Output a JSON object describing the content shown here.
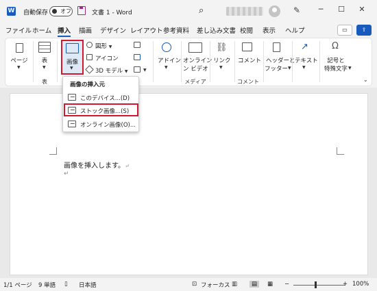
{
  "titlebar": {
    "autosave_label": "自動保存",
    "autosave_state": "オフ",
    "doc_title": "文書 1  -  Word",
    "search_icon": "search-icon",
    "minimize": "─",
    "maximize": "☐",
    "close": "✕"
  },
  "tabs": [
    "ファイル",
    "ホーム",
    "挿入",
    "描画",
    "デザイン",
    "レイアウト",
    "参考資料",
    "差し込み文書",
    "校閲",
    "表示",
    "ヘルプ"
  ],
  "active_tab": "挿入",
  "ribbon": {
    "page": "ページ",
    "table": "表",
    "picture": "画像",
    "shapes": "図形",
    "icons": "アイコン",
    "model3d": "3D モデル",
    "addins": "アドイン",
    "online_video_1": "オンライン",
    "online_video_2": "ン ビデオ",
    "link": "リンク",
    "comment": "コメント",
    "header_footer_1": "ヘッダーと",
    "header_footer_2": "フッター",
    "text": "テキスト",
    "symbols_1": "記号と",
    "symbols_2": "特殊文字",
    "group_table": "表",
    "group_media": "メディア",
    "group_comment": "コメント"
  },
  "dropdown": {
    "header": "画像の挿入元",
    "items": [
      "このデバイス...(D)",
      "ストック画像...(S)",
      "オンライン画像(O)..."
    ],
    "highlighted": "ストック画像...(S)"
  },
  "document": {
    "line1": "画像を挿入します。",
    "para_mark": "↵"
  },
  "statusbar": {
    "page": "1/1 ページ",
    "words": "9 単語",
    "language": "日本語",
    "focus": "フォーカス",
    "zoom": "100%"
  },
  "colors": {
    "word_blue": "#185abd",
    "highlight_red": "#d3172e"
  }
}
